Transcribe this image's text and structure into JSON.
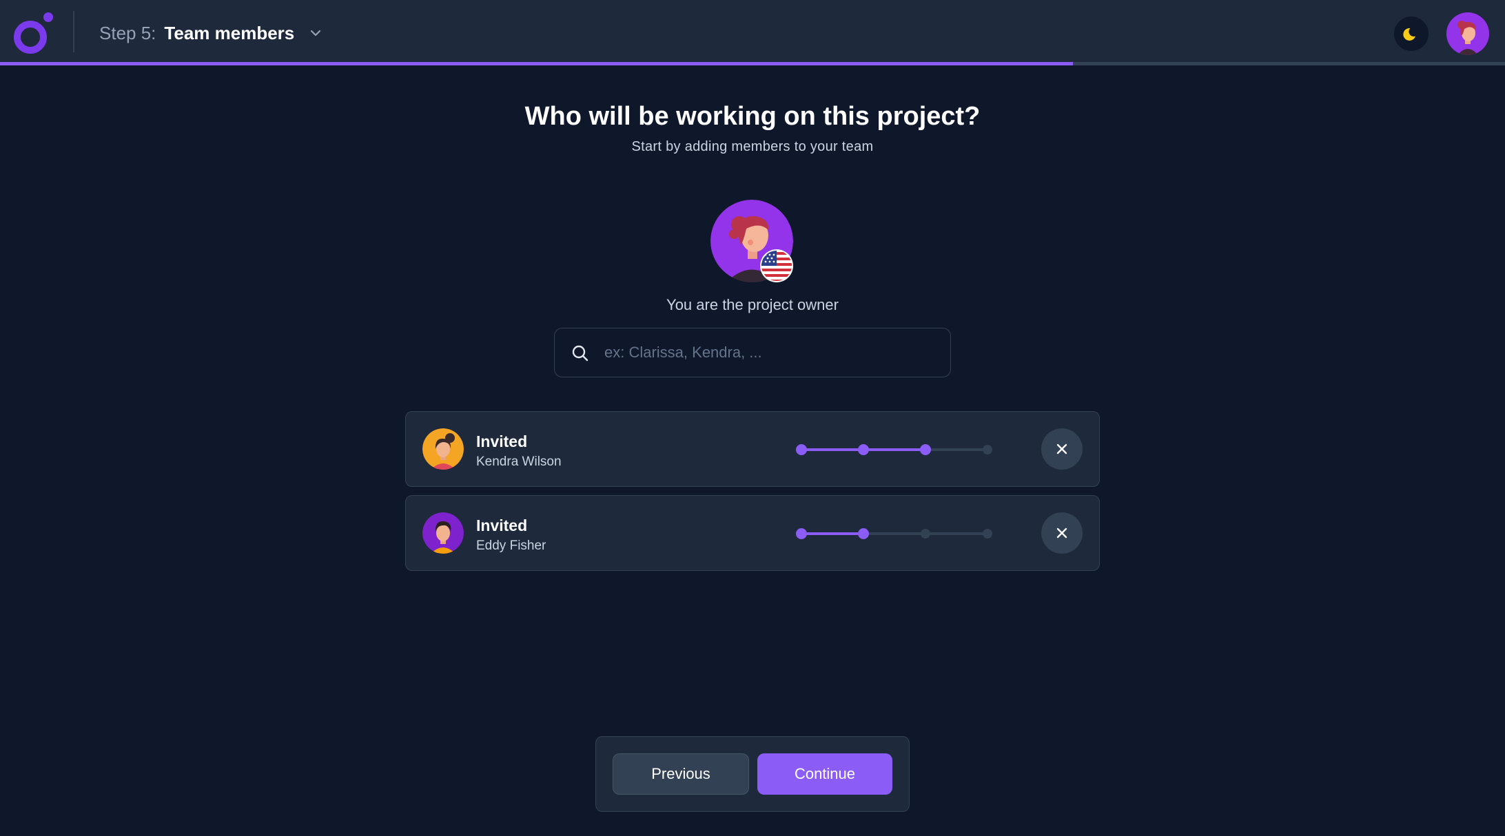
{
  "header": {
    "step_prefix": "Step 5:",
    "step_name": "Team members",
    "progress_fraction": 0.713
  },
  "main": {
    "title": "Who will be working on this project?",
    "subtitle": "Start by adding members to your team",
    "owner_label": "You are the project owner",
    "search": {
      "placeholder": "ex: Clarissa, Kendra, ..."
    }
  },
  "members": [
    {
      "status": "Invited",
      "name": "Kendra Wilson",
      "steps_total": 4,
      "steps_done": 3
    },
    {
      "status": "Invited",
      "name": "Eddy Fisher",
      "steps_total": 4,
      "steps_done": 2
    }
  ],
  "footer": {
    "previous_label": "Previous",
    "continue_label": "Continue"
  },
  "colors": {
    "accent": "#8b5cf6",
    "background": "#0f172a",
    "panel": "#1e293b",
    "border": "#334155",
    "moon": "#facc15"
  },
  "icons": {
    "logo": "logo-icon",
    "theme": "moon-icon",
    "dropdown": "chevron-down-icon",
    "search": "search-icon",
    "remove": "close-icon",
    "flag": "us-flag-icon"
  }
}
